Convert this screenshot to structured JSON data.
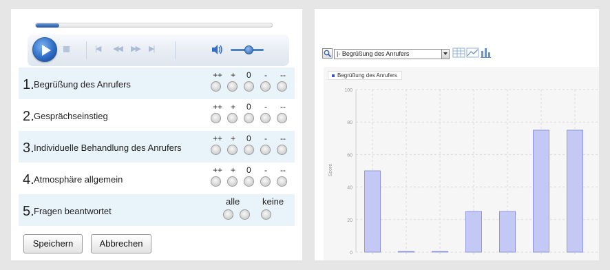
{
  "questions": [
    {
      "num": "1.",
      "label": "Begrüßung des Anrufers",
      "scale": [
        "++",
        "+",
        "0",
        "-",
        "--"
      ]
    },
    {
      "num": "2.",
      "label": "Gesprächseinstieg",
      "scale": [
        "++",
        "+",
        "0",
        "-",
        "--"
      ]
    },
    {
      "num": "3.",
      "label": "Individuelle Behandlung des Anrufers",
      "scale": [
        "++",
        "+",
        "0",
        "-",
        "--"
      ]
    },
    {
      "num": "4.",
      "label": "Atmosphäre allgemein",
      "scale": [
        "++",
        "+",
        "0",
        "-",
        "--"
      ]
    },
    {
      "num": "5.",
      "label": "Fragen beantwortet",
      "scale": [
        "alle",
        "keine"
      ]
    }
  ],
  "buttons": {
    "save": "Speichern",
    "cancel": "Abbrechen"
  },
  "player": {
    "seek_progress": 0.04,
    "volume_level": 0.55,
    "icons": [
      "play-icon",
      "stop-icon",
      "skip-back-icon",
      "rewind-icon",
      "fast-forward-icon",
      "skip-forward-icon",
      "volume-icon"
    ]
  },
  "chart_toolbar": {
    "selected_series": "|- Begrüßung des Anrufers",
    "icons": [
      "zoom-icon",
      "table-view-icon",
      "line-chart-icon",
      "bar-chart-icon"
    ]
  },
  "chart_data": {
    "type": "bar",
    "series": [
      {
        "name": "Begrüßung des Anrufers",
        "values": [
          50,
          0,
          0,
          25,
          25,
          75,
          75
        ]
      }
    ],
    "ylabel": "Score",
    "ylim": [
      0,
      100
    ],
    "yticks": [
      "0",
      "20",
      "40",
      "60",
      "80",
      "100"
    ],
    "grid": true,
    "legend_position": "top-left",
    "colors": {
      "bar_fill": "#c3c8f5",
      "bar_stroke": "#8f97e0",
      "legend_marker": "#3a52c4"
    }
  }
}
